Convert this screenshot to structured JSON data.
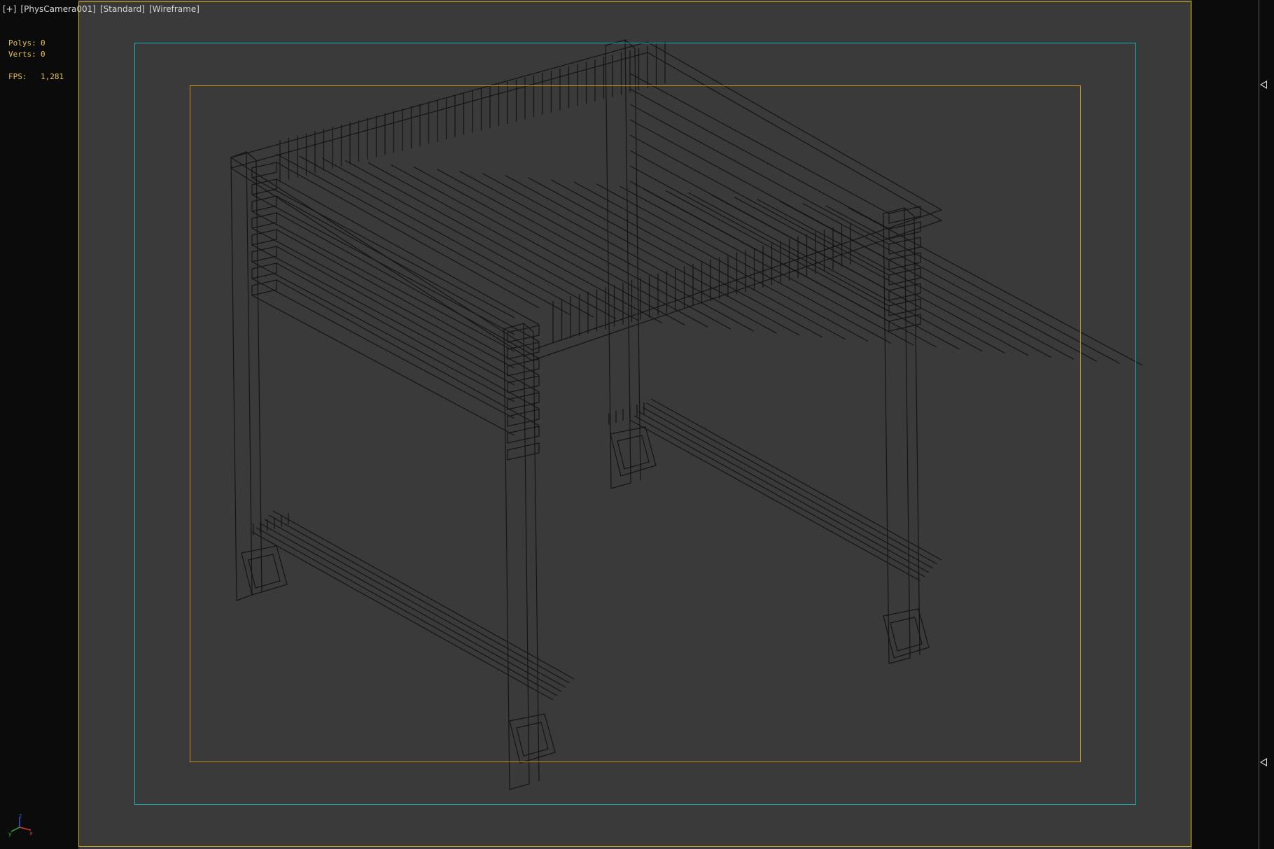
{
  "viewport": {
    "menu": "[+]",
    "camera": "[PhysCamera001]",
    "shading": "[Standard]",
    "mode": "[Wireframe]"
  },
  "stats": {
    "polys_label": "Polys:",
    "polys_value": "0",
    "verts_label": "Verts:",
    "verts_value": "0",
    "fps_label": "FPS:",
    "fps_value": "1,281"
  },
  "axes": {
    "x": "x",
    "y": "y",
    "z": "z"
  },
  "colors": {
    "viewport_bg": "#3a3a3a",
    "frame_outer": "#19a9b3",
    "frame_inner": "#c9921d",
    "border": "#caa81a",
    "stats": "#e8c14a"
  }
}
